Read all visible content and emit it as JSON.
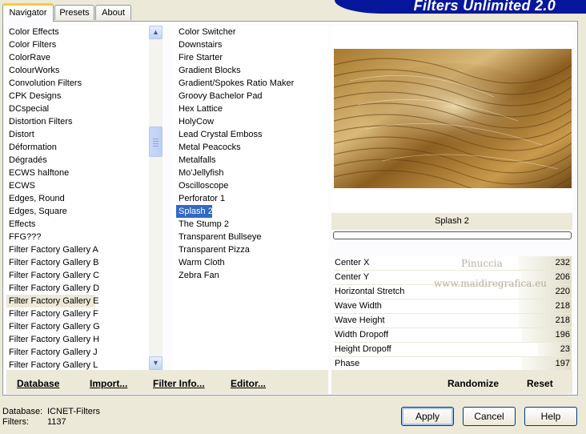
{
  "tabs": [
    {
      "label": "Navigator"
    },
    {
      "label": "Presets"
    },
    {
      "label": "About"
    }
  ],
  "banner": {
    "title": "Filters Unlimited 2.0"
  },
  "categories": [
    "Color Effects",
    "Color Filters",
    "ColorRave",
    "ColourWorks",
    "Convolution Filters",
    "CPK Designs",
    "DCspecial",
    "Distortion Filters",
    "Distort",
    "Déformation",
    "Dégradés",
    "ECWS halftone",
    "ECWS",
    "Edges, Round",
    "Edges, Square",
    "Effects",
    "FFG???",
    "Filter Factory Gallery A",
    "Filter Factory Gallery B",
    "Filter Factory Gallery C",
    "Filter Factory Gallery D",
    "Filter Factory Gallery E",
    "Filter Factory Gallery F",
    "Filter Factory Gallery G",
    "Filter Factory Gallery H",
    "Filter Factory Gallery J",
    "Filter Factory Gallery L"
  ],
  "selected_category": "Filter Factory Gallery E",
  "filters": [
    "Color Switcher",
    "Downstairs",
    "Fire Starter",
    "Gradient Blocks",
    "Gradient/Spokes Ratio Maker",
    "Groovy Bachelor Pad",
    "Hex Lattice",
    "HolyCow",
    "Lead Crystal Emboss",
    "Metal Peacocks",
    "Metalfalls",
    "Mo'Jellyfish",
    "Oscilloscope",
    "Perforator 1",
    "Splash 2",
    "The Stump 2",
    "Transparent Bullseye",
    "Transparent Pizza",
    "Warm Cloth",
    "Zebra Fan"
  ],
  "selected_filter": "Splash 2",
  "left_actions": {
    "database": "Database",
    "import": "Import...",
    "filter_info": "Filter Info...",
    "editor": "Editor..."
  },
  "preview": {
    "filter_name": "Splash 2"
  },
  "watermark": {
    "line1": "Pinuccia",
    "line2": "www.maidiregrafica.eu"
  },
  "parameters": [
    {
      "name": "Center X",
      "value": "232",
      "fraction": 0.91
    },
    {
      "name": "Center Y",
      "value": "206",
      "fraction": 0.81
    },
    {
      "name": "Horizontal Stretch",
      "value": "220",
      "fraction": 0.86
    },
    {
      "name": "Wave Width",
      "value": "218",
      "fraction": 0.85
    },
    {
      "name": "Wave Height",
      "value": "218",
      "fraction": 0.85
    },
    {
      "name": "Width Dropoff",
      "value": "196",
      "fraction": 0.77
    },
    {
      "name": "Height Dropoff",
      "value": "23",
      "fraction": 0.09
    },
    {
      "name": "Phase",
      "value": "197",
      "fraction": 0.77
    }
  ],
  "right_actions": {
    "randomize": "Randomize",
    "reset": "Reset"
  },
  "status": {
    "database_label": "Database:",
    "database_value": "ICNET-Filters",
    "filters_label": "Filters:",
    "filters_value": "1137"
  },
  "buttons": {
    "apply": "Apply",
    "cancel": "Cancel",
    "help": "Help"
  },
  "colors": {
    "selection": "#316ac5",
    "banner": "#07179b",
    "tab_highlight": "#ffc83c"
  }
}
